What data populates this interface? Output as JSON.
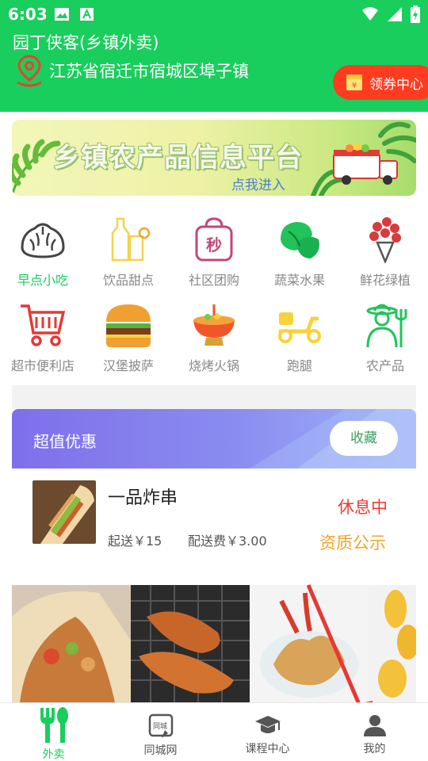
{
  "status_bar": {
    "time": "6:03"
  },
  "header": {
    "app_title": "园丁侠客(乡镇外卖)",
    "location": "江苏省宿迁市宿城区埠子镇",
    "coupon_button": "领券中心",
    "bg_color": "#19ce5d"
  },
  "banner": {
    "title": "乡镇农产品信息平台",
    "subtitle": "点我进入"
  },
  "categories": [
    {
      "label": "早点小吃",
      "icon": "bun-icon",
      "active": true
    },
    {
      "label": "饮品甜点",
      "icon": "drinks-icon"
    },
    {
      "label": "社区团购",
      "icon": "flash-sale-bag-icon"
    },
    {
      "label": "蔬菜水果",
      "icon": "vegetables-icon"
    },
    {
      "label": "鲜花绿植",
      "icon": "flower-bouquet-icon"
    },
    {
      "label": "超市便利店",
      "icon": "shopping-cart-icon"
    },
    {
      "label": "汉堡披萨",
      "icon": "burger-icon"
    },
    {
      "label": "烧烤火锅",
      "icon": "hotpot-icon"
    },
    {
      "label": "跑腿",
      "icon": "scooter-icon"
    },
    {
      "label": "农产品",
      "icon": "farmer-icon"
    }
  ],
  "deals": {
    "title": "超值优惠",
    "collect_button": "收藏"
  },
  "store": {
    "name": "一品炸串",
    "min_order": "起送￥15",
    "delivery_fee": "配送费￥3.00",
    "status": "休息中",
    "qualification": "资质公示"
  },
  "tabbar": [
    {
      "label": "外卖",
      "icon": "fork-spoon-icon",
      "active": true
    },
    {
      "label": "同城网",
      "icon": "city-net-icon"
    },
    {
      "label": "课程中心",
      "icon": "graduation-cap-icon"
    },
    {
      "label": "我的",
      "icon": "user-icon"
    }
  ],
  "colors": {
    "accent": "#19ce5d",
    "coupon": "#ff3c1f",
    "status_closed": "#ee3a32",
    "qualification": "#f0a628"
  }
}
